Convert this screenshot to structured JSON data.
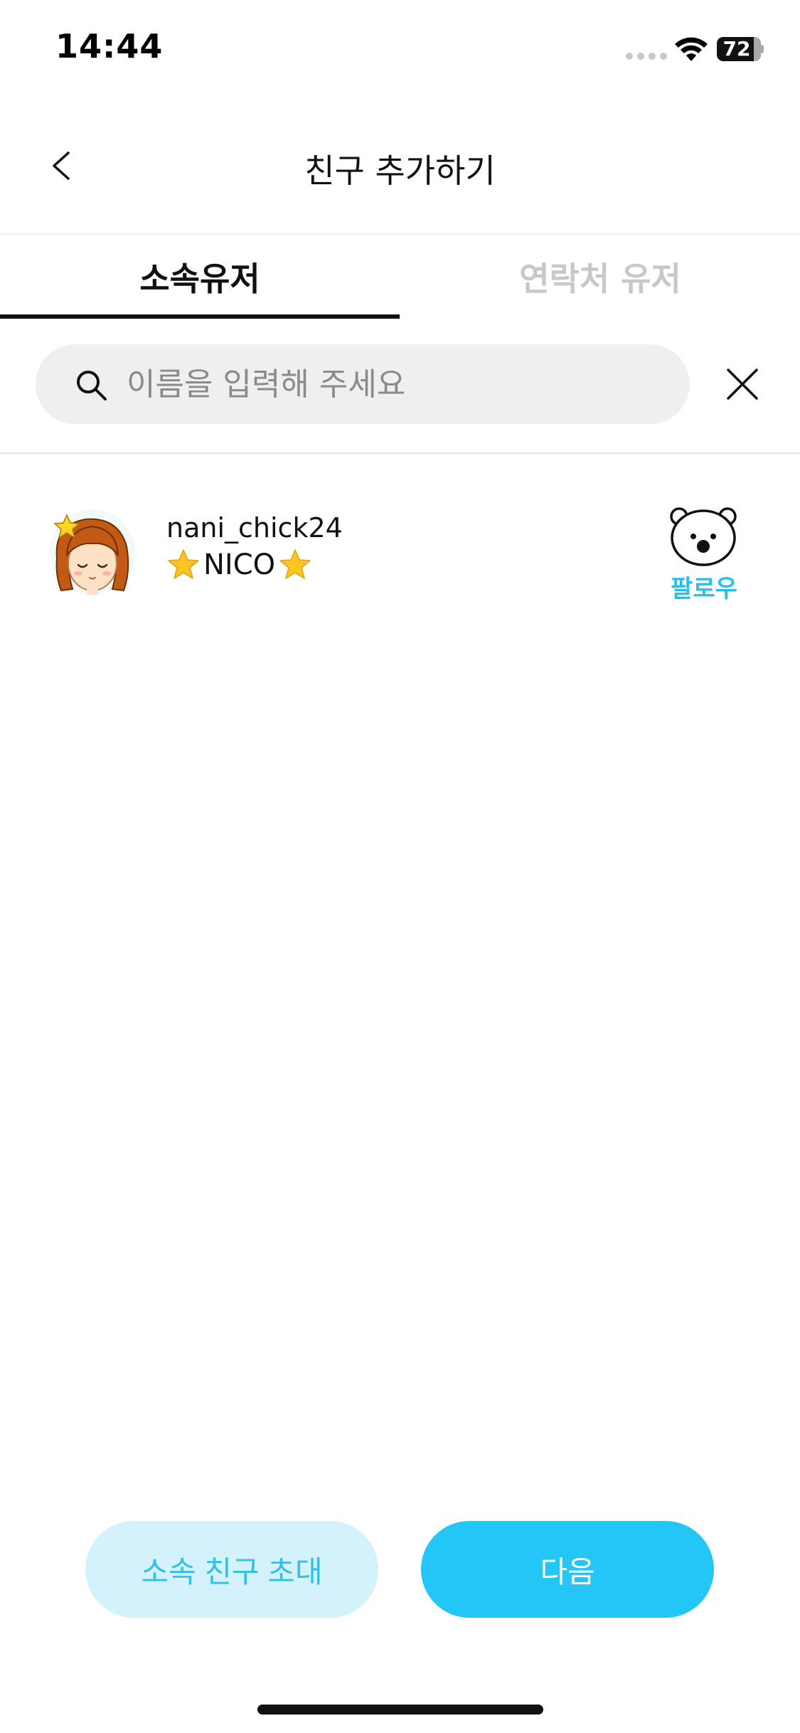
{
  "status_bar": {
    "time": "14:44",
    "battery_level": "72"
  },
  "header": {
    "title": "친구 추가하기",
    "back_icon": "chevron-left-icon"
  },
  "tabs": [
    {
      "label": "소속유저",
      "active": true
    },
    {
      "label": "연락처 유저",
      "active": false
    }
  ],
  "search": {
    "placeholder": "이름을 입력해 주세요",
    "value": "",
    "clear_icon": "close-icon"
  },
  "users": [
    {
      "username": "nani_chick24",
      "display_name": "NICO",
      "decoration": "⭐",
      "follow_label": "팔로우",
      "follow_icon": "bear-icon"
    }
  ],
  "actions": {
    "invite_label": "소속 친구 초대",
    "next_label": "다음"
  },
  "colors": {
    "accent": "#22c7f7",
    "accent_light": "#d4f2fb",
    "follow_text": "#22c1ef",
    "inactive_tab": "#c8c8c8"
  }
}
